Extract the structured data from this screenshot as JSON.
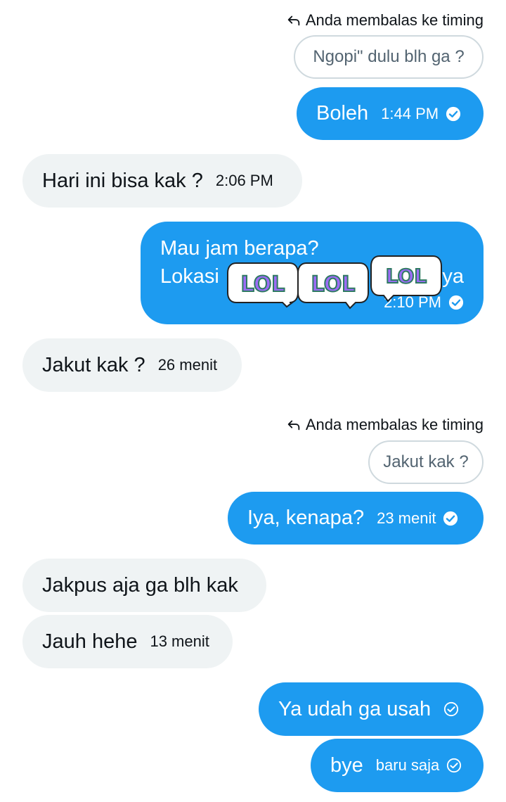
{
  "messages": [
    {
      "reply_header": "Anda membalas ke timing",
      "quote": "Ngopi\" dulu blh ga ?"
    },
    {
      "text": "Boleh",
      "time": "1:44 PM",
      "status": "read-check-icon"
    },
    {
      "text": "Hari ini bisa kak ?",
      "time": "2:06 PM"
    },
    {
      "line1": "Mau jam berapa?",
      "line2_start": "Lokasi",
      "line2_end": "ya",
      "time": "2:10 PM",
      "sticker_text": "LOL",
      "status": "read-check-icon"
    },
    {
      "text": "Jakut kak ?",
      "time": "26 menit"
    },
    {
      "reply_header": "Anda membalas ke timing",
      "quote": "Jakut kak ?"
    },
    {
      "text": "Iya, kenapa?",
      "time": "23 menit",
      "status": "read-check-icon"
    },
    {
      "text": "Jakpus aja ga blh kak"
    },
    {
      "text": "Jauh hehe",
      "time": "13 menit"
    },
    {
      "text": "Ya udah ga usah",
      "status": "sent-check-icon"
    },
    {
      "text": "bye",
      "time": "baru saja",
      "status": "sent-check-icon"
    }
  ],
  "colors": {
    "sent_bubble": "#1d9bf0",
    "received_bubble": "#eff3f4",
    "quote_border": "#cfd9de",
    "quote_text": "#536471",
    "sticker_fill": "#9b6cf5",
    "sticker_edge": "#2f7a62"
  },
  "icons": {
    "reply": "reply-arrow-icon",
    "read": "read-check-icon",
    "sent": "sent-check-icon"
  }
}
